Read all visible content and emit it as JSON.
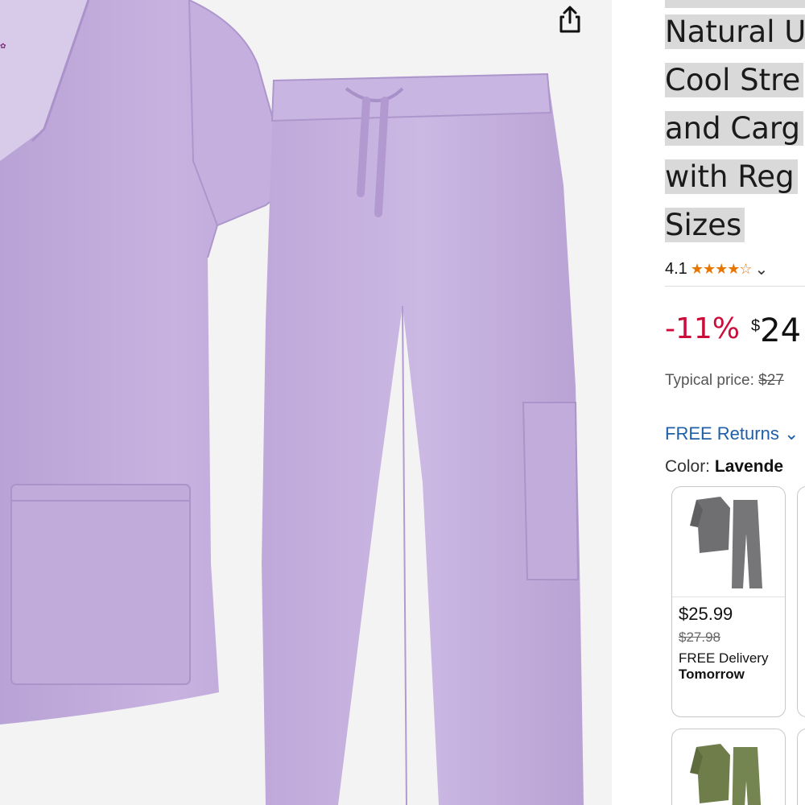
{
  "product": {
    "title_lines": [
      "Natural U",
      "Cool Stre",
      "and Carg",
      "with Reg",
      "Sizes"
    ],
    "rating": "4.1",
    "stars_filled": "★★★★",
    "stars_empty": "☆",
    "discount": "-11%",
    "currency": "$",
    "price_whole": "24",
    "typical_label": "Typical price:",
    "typical_value": "$27",
    "free_returns": "FREE Returns",
    "color_label": "Color:",
    "color_value": "Lavende"
  },
  "variants": [
    {
      "price": "$25.99",
      "old_price": "$27.98",
      "delivery_1": "FREE Delivery",
      "delivery_2": "Tomorrow",
      "color": "#6f6f72"
    },
    {
      "color": "#6e7d4a"
    }
  ],
  "colors": {
    "accent_red": "#cc0c39",
    "link_blue": "#1f5fa8",
    "star": "#e77600",
    "scrub": "#c3addc"
  },
  "icons": {
    "share": "share-icon",
    "chevron": "chevron-down-icon"
  }
}
